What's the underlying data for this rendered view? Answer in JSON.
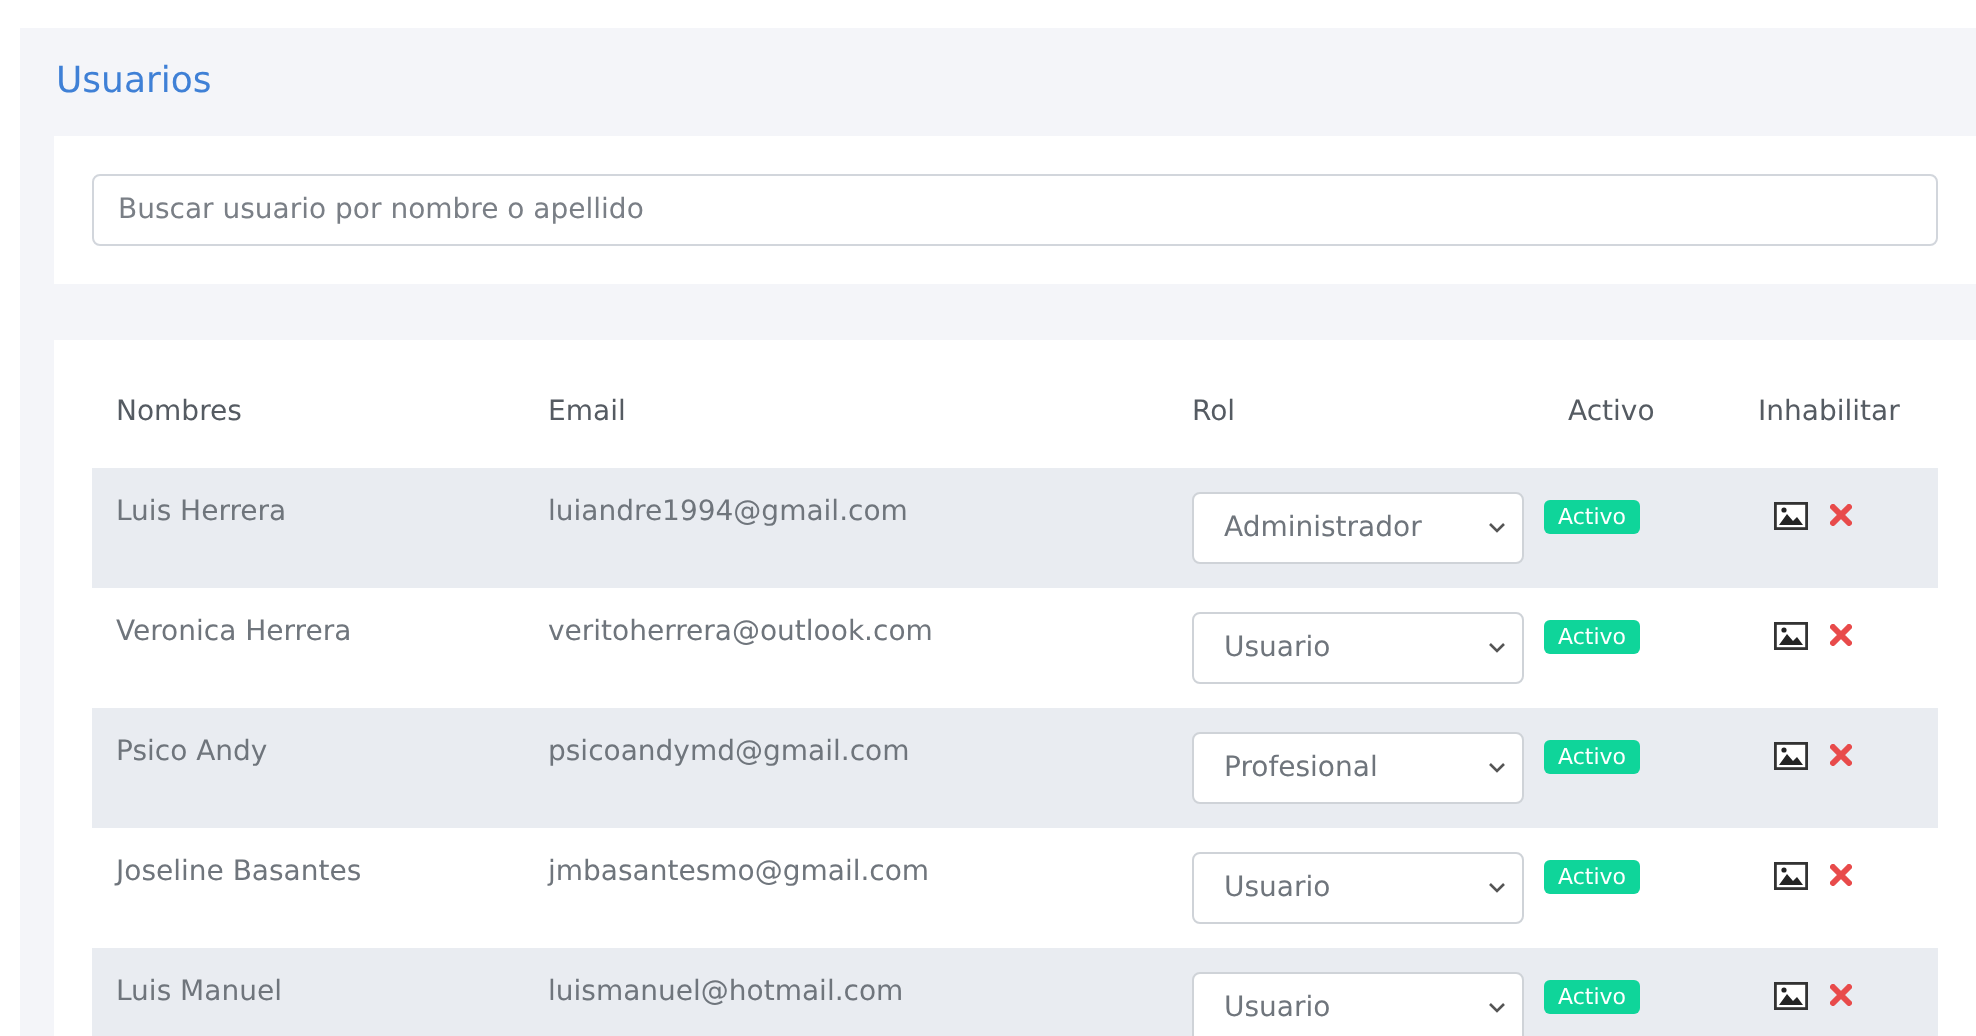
{
  "title": "Usuarios",
  "search": {
    "placeholder": "Buscar usuario por nombre o apellido"
  },
  "table": {
    "columns": [
      "Nombres",
      "Email",
      "Rol",
      "Activo",
      "Inhabilitar"
    ],
    "rows": [
      {
        "name": "Luis Herrera",
        "email": "luiandre1994@gmail.com",
        "role": "Administrador",
        "status": "Activo"
      },
      {
        "name": "Veronica Herrera",
        "email": "veritoherrera@outlook.com",
        "role": "Usuario",
        "status": "Activo"
      },
      {
        "name": "Psico Andy",
        "email": "psicoandymd@gmail.com",
        "role": "Profesional",
        "status": "Activo"
      },
      {
        "name": "Joseline Basantes",
        "email": "jmbasantesmo@gmail.com",
        "role": "Usuario",
        "status": "Activo"
      },
      {
        "name": "Luis Manuel",
        "email": "luismanuel@hotmail.com",
        "role": "Usuario",
        "status": "Activo"
      }
    ]
  }
}
